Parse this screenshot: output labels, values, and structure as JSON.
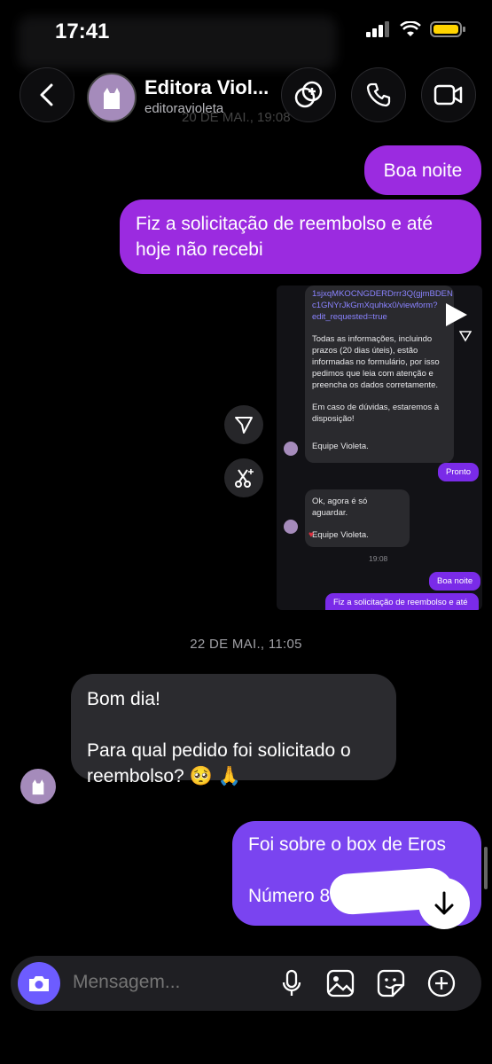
{
  "status": {
    "time": "17:41"
  },
  "ghost_date": "20 DE MAI., 19:08",
  "header": {
    "name": "Editora Viol...",
    "username": "editoravioleta"
  },
  "messages": {
    "out_1": "Boa noite",
    "out_2": "Fiz a solicitação de reembolso e até hoje não recebi",
    "date_separator": "22 DE MAI., 11:05",
    "in_1_line1": "Bom dia!",
    "in_1_line2": "Para qual pedido foi solicitado o reembolso? 🥺 🙏",
    "out_3_line1": "Foi sobre o box de Eros",
    "out_3_line2": "Número 8"
  },
  "screenshot": {
    "link_top": "1sjxqMKOCNGDERDrrr3Q(gjmBDEN",
    "link_mid": "c1GNYrJkGmXquhkx0/viewform?",
    "link_end": "edit_requested=true",
    "info": "Todas as informações, incluindo prazos (20 dias úteis), estão informadas no formulário, por isso pedimos que leia com atenção e preencha os dados corretamente.",
    "doubts": "Em caso de dúvidas, estaremos à disposição!",
    "sign1": "Equipe Violeta.",
    "pronto": "Pronto",
    "reply": "Ok, agora é só aguardar.",
    "sign2": "Equipe Violeta.",
    "time": "19:08",
    "boa_noite": "Boa noite",
    "fiz": "Fiz a solicitação de reembolso e até"
  },
  "composer": {
    "placeholder": "Mensagem..."
  },
  "colors": {
    "outgoing": "#9b2be0",
    "incoming": "#2b2b2f",
    "camera": "#6d5cff"
  }
}
